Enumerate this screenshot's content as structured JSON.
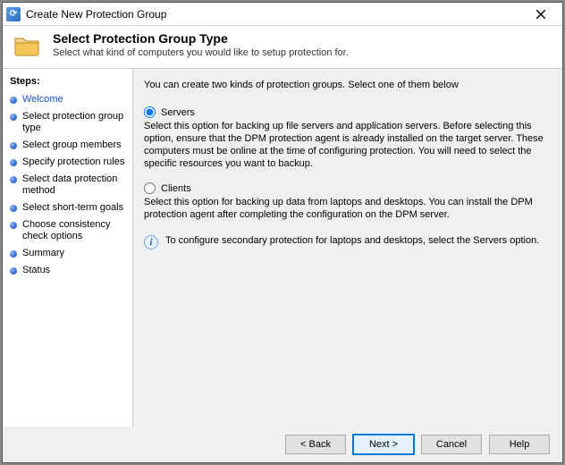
{
  "window": {
    "title": "Create New Protection Group"
  },
  "header": {
    "title": "Select Protection Group Type",
    "subtitle": "Select what kind of computers you would like to setup protection for."
  },
  "sidebar": {
    "steps_label": "Steps:",
    "items": [
      {
        "label": "Welcome",
        "state": "completed"
      },
      {
        "label": "Select protection group type",
        "state": "current"
      },
      {
        "label": "Select group members",
        "state": "pending"
      },
      {
        "label": "Specify protection rules",
        "state": "pending"
      },
      {
        "label": "Select data protection method",
        "state": "pending"
      },
      {
        "label": "Select short-term goals",
        "state": "pending"
      },
      {
        "label": "Choose consistency check options",
        "state": "pending"
      },
      {
        "label": "Summary",
        "state": "pending"
      },
      {
        "label": "Status",
        "state": "pending"
      }
    ]
  },
  "content": {
    "intro": "You can create two kinds of protection groups. Select one of them below",
    "options": [
      {
        "id": "servers",
        "label": "Servers",
        "checked": true,
        "desc": "Select this option for backing up file servers and application servers. Before selecting this option, ensure that the DPM protection agent is already installed on the target server. These computers must be online at the time of configuring protection. You will need to select the specific resources you want to backup."
      },
      {
        "id": "clients",
        "label": "Clients",
        "checked": false,
        "desc": "Select this option for backing up data from laptops and desktops. You can install the DPM protection agent after completing the configuration on the DPM server."
      }
    ],
    "info": "To configure secondary protection for laptops and desktops, select the Servers option."
  },
  "footer": {
    "back": "< Back",
    "next": "Next >",
    "cancel": "Cancel",
    "help": "Help"
  }
}
